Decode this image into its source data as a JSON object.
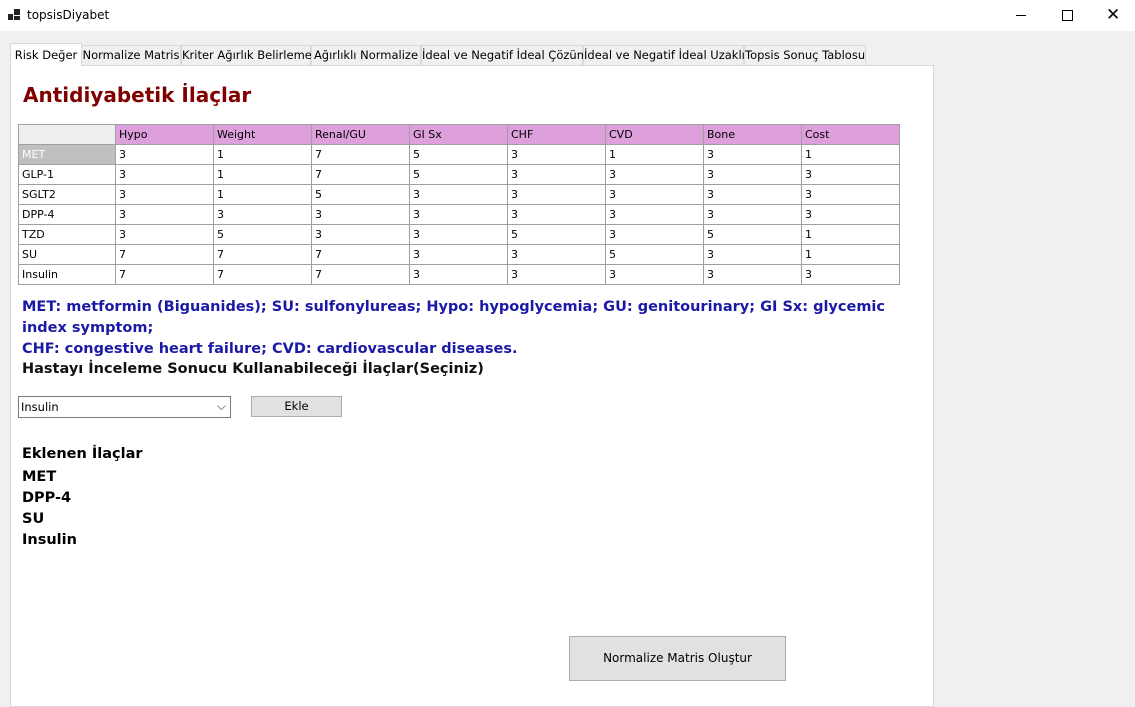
{
  "window": {
    "title": "topsisDiyabet",
    "controls": {
      "minimize": "—",
      "maximize": "☐",
      "close": "✕"
    }
  },
  "tabs": [
    "Risk Değer",
    "Normalize Matris",
    "Kriter Ağırlık Belirleme",
    "Ağırlıklı Normalize",
    "İdeal ve Negatif İdeal Çözüm",
    "İdeal ve Negatif İdeal Uzaklık",
    "Topsis Sonuç Tablosu"
  ],
  "active_tab": 0,
  "main": {
    "heading": "Antidiyabetik İlaçlar",
    "table": {
      "columns": [
        "Hypo",
        "Weight",
        "Renal/GU",
        "GI Sx",
        "CHF",
        "CVD",
        "Bone",
        "Cost"
      ],
      "rows": [
        {
          "name": "MET",
          "values": [
            "3",
            "1",
            "7",
            "5",
            "3",
            "1",
            "3",
            "1"
          ],
          "selected": true
        },
        {
          "name": "GLP-1",
          "values": [
            "3",
            "1",
            "7",
            "5",
            "3",
            "3",
            "3",
            "3"
          ]
        },
        {
          "name": "SGLT2",
          "values": [
            "3",
            "1",
            "5",
            "3",
            "3",
            "3",
            "3",
            "3"
          ]
        },
        {
          "name": "DPP-4",
          "values": [
            "3",
            "3",
            "3",
            "3",
            "3",
            "3",
            "3",
            "3"
          ]
        },
        {
          "name": "TZD",
          "values": [
            "3",
            "5",
            "3",
            "3",
            "5",
            "3",
            "5",
            "1"
          ]
        },
        {
          "name": "SU",
          "values": [
            "7",
            "7",
            "7",
            "3",
            "3",
            "5",
            "3",
            "1"
          ]
        },
        {
          "name": "Insulin",
          "values": [
            "7",
            "7",
            "7",
            "3",
            "3",
            "3",
            "3",
            "3"
          ]
        }
      ]
    },
    "note_line1": "MET: metformin (Biguanides); SU: sulfonylureas; Hypo: hypoglycemia; GU: genitourinary; GI Sx: glycemic index symptom;",
    "note_line2": "CHF: congestive heart failure; CVD: cardiovascular diseases.",
    "select_prompt": "Hastayı İnceleme Sonucu Kullanabileceği İlaçlar(Seçiniz)",
    "combo_value": "Insulin",
    "add_button": "Ekle",
    "added_title": "Eklenen İlaçlar",
    "added_items": [
      "MET",
      "DPP-4",
      "SU",
      "Insulin"
    ],
    "normalize_button": "Normalize Matris Oluştur"
  }
}
